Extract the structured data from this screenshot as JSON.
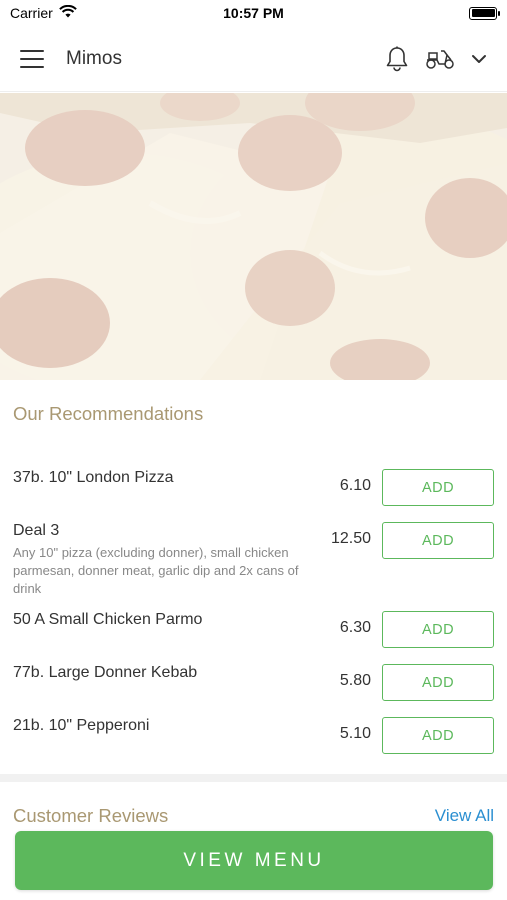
{
  "status_bar": {
    "carrier": "Carrier",
    "time": "10:57 PM"
  },
  "header": {
    "title": "Mimos",
    "icons": [
      "menu-icon",
      "bell-icon",
      "scooter-icon",
      "chevron-down-icon"
    ]
  },
  "hero": {
    "image": "pepperoni-pizza-photo"
  },
  "recommendations": {
    "title": "Our Recommendations",
    "items": [
      {
        "name": "37b. 10\" London Pizza",
        "description": "",
        "price": "6.10",
        "button": "ADD"
      },
      {
        "name": "Deal 3",
        "description": "Any 10\" pizza (excluding donner), small chicken parmesan, donner meat, garlic dip and 2x cans of drink",
        "price": "12.50",
        "button": "ADD"
      },
      {
        "name": "50 A Small Chicken Parmo",
        "description": "",
        "price": "6.30",
        "button": "ADD"
      },
      {
        "name": "77b. Large Donner Kebab",
        "description": "",
        "price": "5.80",
        "button": "ADD"
      },
      {
        "name": "21b. 10\" Pepperoni",
        "description": "",
        "price": "5.10",
        "button": "ADD"
      }
    ]
  },
  "reviews": {
    "title": "Customer Reviews",
    "view_all": "View All"
  },
  "footer": {
    "view_menu": "VIEW MENU"
  },
  "colors": {
    "accent_green": "#5cb85c",
    "section_title": "#a99872",
    "link_blue": "#2b8fd1"
  }
}
